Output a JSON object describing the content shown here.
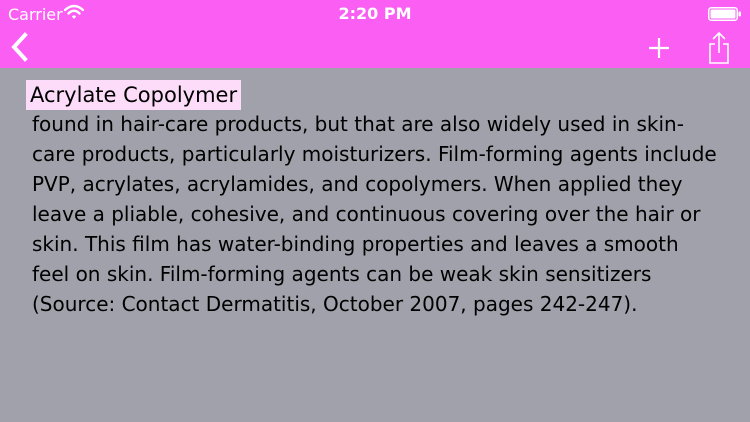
{
  "status_bar": {
    "carrier": "Carrier",
    "time": "2:20 PM",
    "wifi_icon": "wifi-icon",
    "battery_icon": "battery-full-icon"
  },
  "nav_bar": {
    "back_icon": "chevron-left-icon",
    "add_icon": "plus-icon",
    "share_icon": "share-icon"
  },
  "content": {
    "title": "Acrylate Copolymer",
    "body": "found in hair-care products, but that are also widely used in skin-care products, particularly moisturizers. Film-forming agents include PVP, acrylates, acrylamides, and copolymers. When applied they leave a pliable, cohesive, and continuous covering over the hair or skin. This film has water-binding properties and leaves a smooth feel on skin. Film-forming agents can be weak skin sensitizers (Source: Contact Dermatitis, October 2007, pages 242-247)."
  },
  "colors": {
    "header_background": "#fb5ef3",
    "content_background": "#a0a1aa",
    "title_highlight": "#fcdcf8",
    "icon_color": "#ffffff"
  }
}
